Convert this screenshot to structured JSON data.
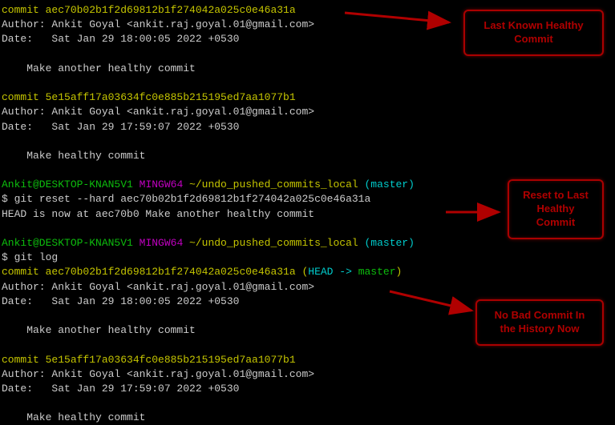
{
  "log1": {
    "commit1": {
      "hash": "commit aec70b02b1f2d69812b1f274042a025c0e46a31a",
      "author": "Author: Ankit Goyal <ankit.raj.goyal.01@gmail.com>",
      "date": "Date:   Sat Jan 29 18:00:05 2022 +0530",
      "msg": "    Make another healthy commit"
    },
    "commit2": {
      "hash": "commit 5e15aff17a03634fc0e885b215195ed7aa1077b1",
      "author": "Author: Ankit Goyal <ankit.raj.goyal.01@gmail.com>",
      "date": "Date:   Sat Jan 29 17:59:07 2022 +0530",
      "msg": "    Make healthy commit"
    }
  },
  "prompt": {
    "userhost": "Ankit@DESKTOP-KNAN5V1",
    "sep": " ",
    "shell": "MINGW64",
    "path": " ~/undo_pushed_commits_local",
    "branch_open": " (",
    "branch": "master",
    "branch_close": ")"
  },
  "cmd1": {
    "ps": "$ ",
    "text": "git reset --hard aec70b02b1f2d69812b1f274042a025c0e46a31a"
  },
  "reset_out": "HEAD is now at aec70b0 Make another healthy commit",
  "cmd2": {
    "ps": "$ ",
    "text": "git log"
  },
  "log2": {
    "commit1": {
      "hash_prefix": "commit aec70b02b1f2d69812b1f274042a025c0e46a31a (",
      "head": "HEAD -> ",
      "branch": "master",
      "hash_suffix": ")",
      "author": "Author: Ankit Goyal <ankit.raj.goyal.01@gmail.com>",
      "date": "Date:   Sat Jan 29 18:00:05 2022 +0530",
      "msg": "    Make another healthy commit"
    },
    "commit2": {
      "hash": "commit 5e15aff17a03634fc0e885b215195ed7aa1077b1",
      "author": "Author: Ankit Goyal <ankit.raj.goyal.01@gmail.com>",
      "date": "Date:   Sat Jan 29 17:59:07 2022 +0530",
      "msg": "    Make healthy commit"
    }
  },
  "callouts": {
    "c1": "Last Known Healthy\nCommit",
    "c2": "Reset to Last\nHealthy\nCommit",
    "c3": "No Bad Commit In\nthe History Now"
  }
}
